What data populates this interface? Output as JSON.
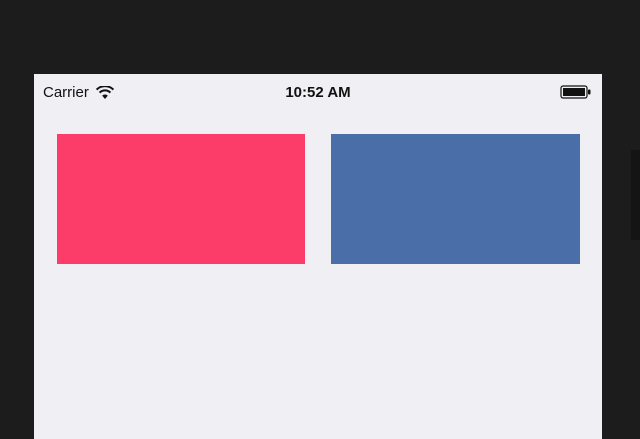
{
  "status_bar": {
    "carrier": "Carrier",
    "time": "10:52 AM",
    "wifi_icon": "wifi-icon",
    "battery_icon": "battery-icon"
  },
  "content": {
    "boxes": [
      {
        "color": "#fc3d6a"
      },
      {
        "color": "#4a6ea8"
      }
    ]
  },
  "colors": {
    "bezel": "#1c1c1c",
    "screen_background": "#efeff4",
    "text": "#111111"
  }
}
